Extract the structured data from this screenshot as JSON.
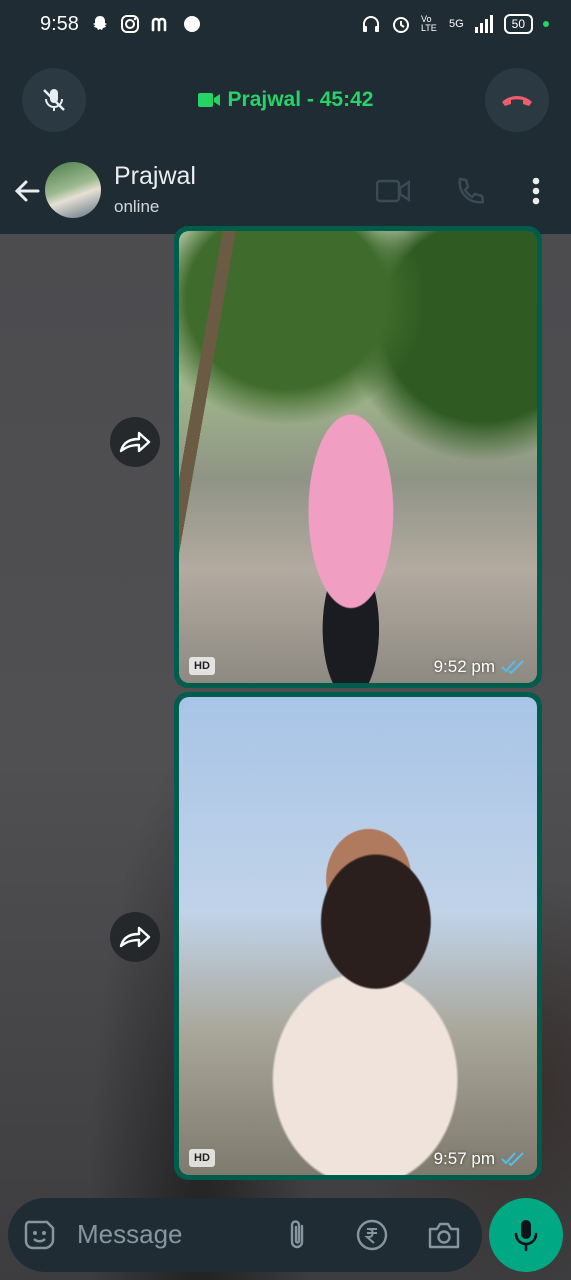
{
  "status_bar": {
    "time": "9:58",
    "battery": "50",
    "network_label": "5G",
    "volte_label": "Vo LTE"
  },
  "call_banner": {
    "text": "Prajwal - 45:42",
    "accent": "#25d366"
  },
  "header": {
    "contact_name": "Prajwal",
    "status": "online"
  },
  "messages": [
    {
      "type": "image",
      "hd": "HD",
      "time": "9:52 pm",
      "read": true
    },
    {
      "type": "image",
      "hd": "HD",
      "time": "9:57 pm",
      "read": true
    }
  ],
  "input": {
    "placeholder": "Message"
  },
  "icons": {
    "mute": "mic-off-icon",
    "end_call": "phone-hangup-icon",
    "video_call": "video-icon",
    "voice_call": "phone-icon",
    "menu": "more-vertical-icon",
    "sticker": "sticker-icon",
    "attach": "paperclip-icon",
    "payment": "rupee-icon",
    "camera": "camera-icon",
    "mic": "mic-icon",
    "forward": "forward-icon"
  },
  "colors": {
    "bar_bg": "#1f2c34",
    "bubble_out": "#005c4b",
    "mic_button": "#00a884",
    "end_call_red": "#f15c6d",
    "read_tick": "#53bdeb"
  }
}
